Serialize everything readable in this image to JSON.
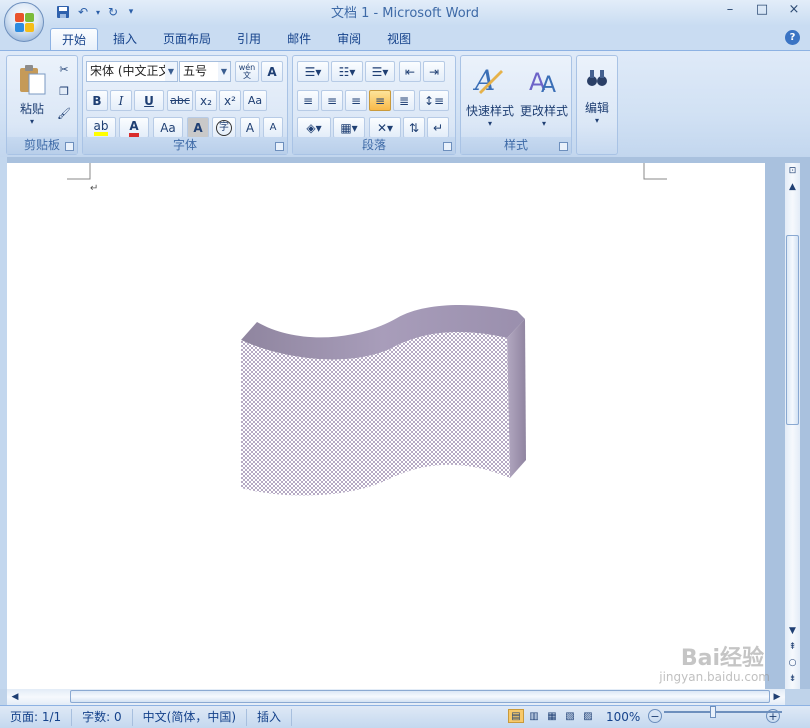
{
  "window": {
    "title": "文档 1 - Microsoft Word",
    "minimize": "–",
    "maximize": "□",
    "close": "×"
  },
  "tabs": [
    "开始",
    "插入",
    "页面布局",
    "引用",
    "邮件",
    "审阅",
    "视图"
  ],
  "ribbon": {
    "clipboard": {
      "label": "剪贴板",
      "paste": "粘贴"
    },
    "font": {
      "label": "字体",
      "font_name": "宋体 (中文正文)",
      "font_size": "五号",
      "phonetic": "wén",
      "bold": "B",
      "italic": "I",
      "underline": "U",
      "strike": "abc",
      "sub": "x₂",
      "sup": "x²",
      "font_color": "A",
      "change_case": "Aa",
      "char_shading": "A",
      "enclose": "字",
      "grow": "A",
      "shrink": "A"
    },
    "paragraph": {
      "label": "段落"
    },
    "styles": {
      "label": "样式",
      "quick_styles": "快速样式",
      "change_styles": "更改样式"
    },
    "editing": {
      "label": "编辑"
    }
  },
  "document": {
    "paragraph_mark": "↵"
  },
  "statusbar": {
    "page": "页面: 1/1",
    "words": "字数: 0",
    "language": "中文(简体，中国)",
    "mode": "插入",
    "zoom": "100%"
  },
  "watermark": {
    "brand": "Bai经验",
    "url": "jingyan.baidu.com"
  },
  "colors": {
    "highlight": "#ffff00",
    "font_color": "#d92b2b",
    "shape_side": "#9f93ad",
    "shape_face_pattern": "#c8bfd6"
  }
}
